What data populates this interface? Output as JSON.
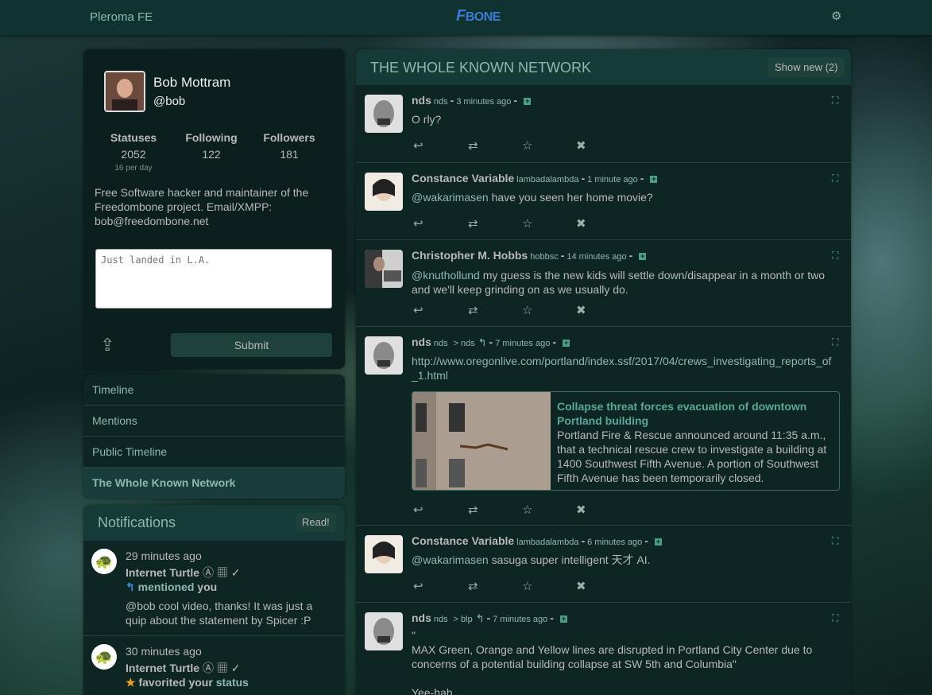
{
  "nav": {
    "title": "Pleroma FE",
    "logo_f": "F",
    "logo_rest": "BONE"
  },
  "user": {
    "name": "Bob Mottram",
    "handle": "@bob",
    "stats": [
      {
        "label": "Statuses",
        "value": "2052",
        "sub": "16 per day"
      },
      {
        "label": "Following",
        "value": "122"
      },
      {
        "label": "Followers",
        "value": "181"
      }
    ],
    "bio": "Free Software hacker and maintainer of the Freedombone project. Email/XMPP: bob@freedombone.net",
    "post_placeholder": "Just landed in L.A.",
    "submit_label": "Submit"
  },
  "sidenav": [
    {
      "label": "Timeline"
    },
    {
      "label": "Mentions"
    },
    {
      "label": "Public Timeline"
    },
    {
      "label": "The Whole Known Network"
    }
  ],
  "notifications": {
    "title": "Notifications",
    "read_label": "Read!",
    "items": [
      {
        "time": "29 minutes ago",
        "name": "Internet Turtle",
        "name_badges": "Ⓐ ▦",
        "verb": "mentioned",
        "target": "you",
        "text": "@bob cool video, thanks! It was just a quip about the statement by Spicer :P"
      },
      {
        "time": "30 minutes ago",
        "name": "Internet Turtle",
        "name_badges": "Ⓐ ▦",
        "verb": "favorited your",
        "target": "status"
      }
    ]
  },
  "timeline": {
    "title": "THE WHOLE KNOWN NETWORK",
    "show_new": "Show new (2)",
    "statuses": [
      {
        "name": "nds",
        "handle": "nds",
        "time": "3 minutes ago",
        "body": "O rly?"
      },
      {
        "name": "Constance Variable",
        "handle": "lambadalambda",
        "time": "1 minute ago",
        "mention": "@wakarimasen",
        "body": " have you seen her home movie?"
      },
      {
        "name": "Christopher M. Hobbs",
        "handle": "hobbsc",
        "time": "14 minutes ago",
        "mention": "@knuthollund",
        "body": " my guess is the new kids will settle down/disappear in a month or two and we'll keep grinding on as we usually do."
      },
      {
        "name": "nds",
        "handle": "nds",
        "reply_to": "> nds",
        "time": "7 minutes ago",
        "link": "http://www.oregonlive.com/portland/index.ssf/2017/04/crews_investigating_reports_of_1.html",
        "card_title": "Collapse threat forces evacuation of downtown Portland building",
        "card_desc": "Portland Fire & Rescue announced around 11:35 a.m., that a technical rescue crew to investigate a building at 1400 Southwest Fifth Avenue. A portion of Southwest Fifth Avenue has been temporarily closed."
      },
      {
        "name": "Constance Variable",
        "handle": "lambadalambda",
        "time": "6 minutes ago",
        "mention": "@wakarimasen",
        "body": " sasuga super intelligent 天才 AI."
      },
      {
        "name": "nds",
        "handle": "nds",
        "reply_to": "> blp",
        "time": "7 minutes ago",
        "quote_open": "\"",
        "body": "MAX Green, Orange and Yellow lines are disrupted in Portland City Center due to concerns of a potential building collapse at SW 5th and Columbia\"",
        "body2": "Yee-hah"
      }
    ]
  },
  "colors": {
    "accent": "#8fb9b0",
    "panel": "#0d2523",
    "header": "#163a36"
  }
}
